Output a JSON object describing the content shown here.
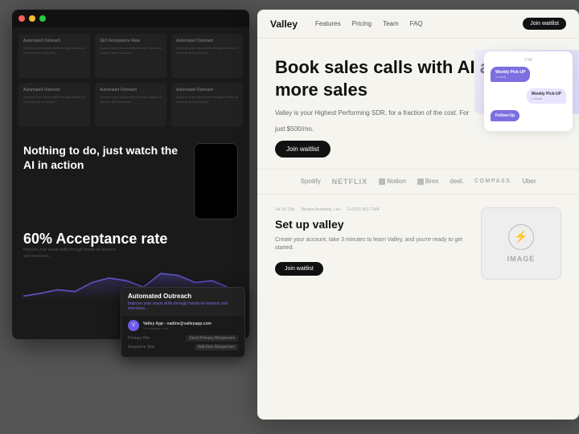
{
  "left_window": {
    "grid_cards": [
      {
        "title": "Automated Outreach",
        "text": "Improve your visual skills through hands-on lessons and exercises..."
      },
      {
        "title": "SEO Acceptance Rate",
        "text": "Improve your visual skills through hands-on lessons and exercises..."
      },
      {
        "title": "Automated Outreach",
        "text": "Improve your visual skills through hands-on lessons and exercises..."
      },
      {
        "title": "Automated Outreach",
        "text": "Improve your visual skills through hands-on lessons and exercises..."
      },
      {
        "title": "Automated Outreach",
        "text": "Improve your visual skills through hands-on lessons and exercises..."
      },
      {
        "title": "Automated Outreach",
        "text": "Improve your visual skills through hands-on lessons and exercises..."
      }
    ],
    "hero": {
      "heading": "Nothing to do, just watch the AI in action"
    },
    "acceptance": {
      "rate": "60% Acceptance rate",
      "desc": "Improve your visual skills through hands-on lessons and exercises..."
    },
    "outreach_card": {
      "header": "Automated Outreach",
      "subtext": "Improve your visual skills through hands-on lessons and exercises...",
      "rows": [
        {
          "label": "Primary Hits",
          "value": "Send Primary Responses"
        },
        {
          "label": "Sequence Site:",
          "value": ""
        }
      ]
    }
  },
  "right_window": {
    "nav": {
      "logo": "Valley",
      "links": [
        "Features",
        "Pricing",
        "Team",
        "FAQ"
      ],
      "cta": "Join waitlist"
    },
    "hero": {
      "heading": "Book sales calls with AI and drive more sales",
      "description": "Valley is your Highest Performing SDR, for a fraction of the cost. For",
      "price": "just $500/mo.",
      "cta": "Join waitlist"
    },
    "chat": {
      "time": "2:40",
      "messages": [
        {
          "side": "left",
          "label": "Weekly Pick-UP",
          "sub": "1 result"
        },
        {
          "side": "right",
          "label": "Weekly Pick-UP",
          "sub": "1 result"
        },
        {
          "side": "left",
          "label": "Follow-Up",
          "sub": ""
        }
      ]
    },
    "logos": [
      {
        "name": "Spotify",
        "style": "normal"
      },
      {
        "name": "NETFLIX",
        "style": "netflix"
      },
      {
        "name": "Notion",
        "style": "normal"
      },
      {
        "name": "Brex",
        "style": "normal"
      },
      {
        "name": "deel.",
        "style": "normal"
      },
      {
        "name": "COMPASS",
        "style": "compass"
      },
      {
        "name": "Uber",
        "style": "normal"
      }
    ],
    "setup": {
      "meta": [
        "Jul 18 12pt",
        "Monika Academy, Lev.",
        "G (919) 961-7344"
      ],
      "heading": "Set up valley",
      "description": "Create your account, take 3 minutes to learn Valley, and you're ready to get started.",
      "cta": "Join waitlist"
    },
    "image_placeholder": "IMAGE"
  }
}
